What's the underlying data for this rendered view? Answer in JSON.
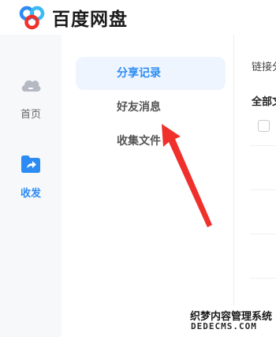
{
  "app": {
    "title": "百度网盘"
  },
  "left_rail": {
    "items": [
      {
        "label": "首页",
        "icon": "cloud-icon",
        "active": false
      },
      {
        "label": "收发",
        "icon": "share-folder-icon",
        "active": true
      }
    ]
  },
  "sub_nav": {
    "items": [
      {
        "label": "分享记录",
        "active": true
      },
      {
        "label": "好友消息",
        "active": false
      },
      {
        "label": "收集文件",
        "active": false
      }
    ]
  },
  "content": {
    "link_label": "链接分",
    "all_label": "全部文"
  },
  "watermark": {
    "line1": "织梦内容管理系统",
    "line2": "DEDECMS.COM"
  },
  "colors": {
    "accent": "#2c8cf4",
    "active_bg": "#eef5ff",
    "rail_bg": "#f7f8fa",
    "arrow": "#f0302a"
  }
}
